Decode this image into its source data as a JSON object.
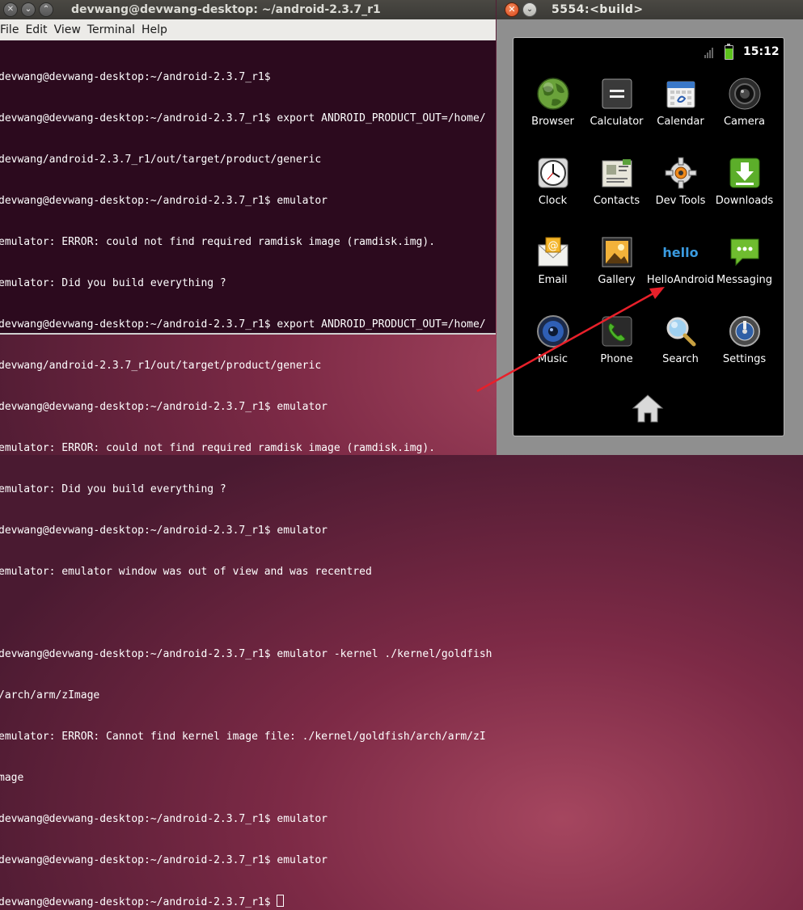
{
  "terminal": {
    "title": "devwang@devwang-desktop: ~/android-2.3.7_r1",
    "menu": [
      "File",
      "Edit",
      "View",
      "Terminal",
      "Help"
    ],
    "lines": [
      "devwang@devwang-desktop:~/android-2.3.7_r1$",
      "devwang@devwang-desktop:~/android-2.3.7_r1$ export ANDROID_PRODUCT_OUT=/home/",
      "devwang/android-2.3.7_r1/out/target/product/generic",
      "devwang@devwang-desktop:~/android-2.3.7_r1$ emulator",
      "emulator: ERROR: could not find required ramdisk image (ramdisk.img).",
      "emulator: Did you build everything ?",
      "devwang@devwang-desktop:~/android-2.3.7_r1$ export ANDROID_PRODUCT_OUT=/home/",
      "devwang/android-2.3.7_r1/out/target/product/generic",
      "devwang@devwang-desktop:~/android-2.3.7_r1$ emulator",
      "emulator: ERROR: could not find required ramdisk image (ramdisk.img).",
      "emulator: Did you build everything ?",
      "devwang@devwang-desktop:~/android-2.3.7_r1$ emulator",
      "emulator: emulator window was out of view and was recentred",
      "",
      "devwang@devwang-desktop:~/android-2.3.7_r1$ emulator -kernel ./kernel/goldfish",
      "/arch/arm/zImage",
      "emulator: ERROR: Cannot find kernel image file: ./kernel/goldfish/arch/arm/zI",
      "mage",
      "devwang@devwang-desktop:~/android-2.3.7_r1$ emulator",
      "devwang@devwang-desktop:~/android-2.3.7_r1$ emulator",
      "devwang@devwang-desktop:~/android-2.3.7_r1$ "
    ]
  },
  "emulator": {
    "title": "5554:<build>",
    "status": {
      "time": "15:12"
    },
    "apps": [
      {
        "label": "Browser",
        "icon": "globe-icon"
      },
      {
        "label": "Calculator",
        "icon": "calculator-icon"
      },
      {
        "label": "Calendar",
        "icon": "calendar-icon"
      },
      {
        "label": "Camera",
        "icon": "camera-icon"
      },
      {
        "label": "Clock",
        "icon": "clock-icon"
      },
      {
        "label": "Contacts",
        "icon": "contacts-icon"
      },
      {
        "label": "Dev Tools",
        "icon": "gear-icon"
      },
      {
        "label": "Downloads",
        "icon": "download-icon"
      },
      {
        "label": "Email",
        "icon": "email-icon"
      },
      {
        "label": "Gallery",
        "icon": "gallery-icon"
      },
      {
        "label": "HelloAndroid",
        "icon": "hello-icon",
        "icon_text": "hello"
      },
      {
        "label": "Messaging",
        "icon": "messaging-icon"
      },
      {
        "label": "Music",
        "icon": "speaker-icon"
      },
      {
        "label": "Phone",
        "icon": "phone-icon"
      },
      {
        "label": "Search",
        "icon": "magnifier-icon"
      },
      {
        "label": "Settings",
        "icon": "settings-icon"
      }
    ]
  },
  "colors": {
    "terminal_bg": "#2c0a1e",
    "arrow": "#e8202a",
    "battery": "#5cc21c",
    "hello_text": "#3a9be0"
  }
}
